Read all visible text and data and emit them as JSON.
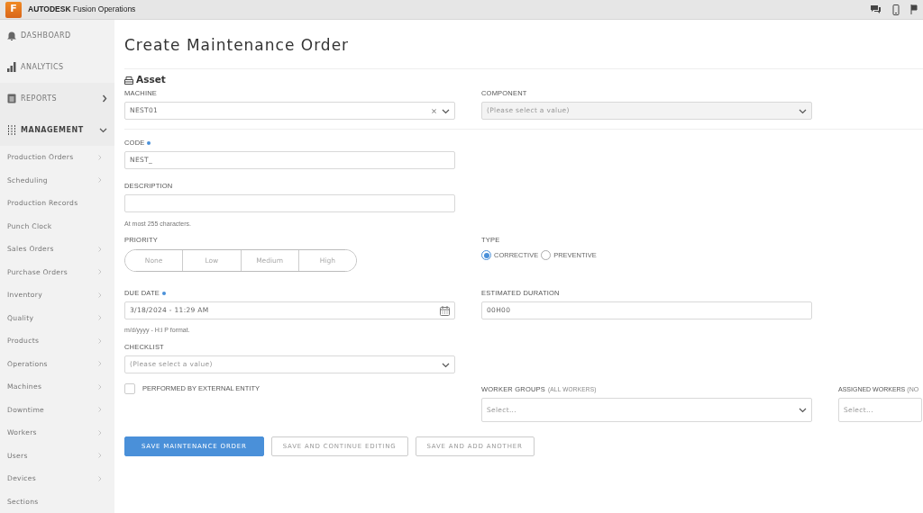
{
  "app": {
    "logo_letter": "F",
    "brand": "AUTODESK",
    "product": "Fusion Operations"
  },
  "sidebar": {
    "sections": [
      {
        "label": "DASHBOARD"
      },
      {
        "label": "ANALYTICS"
      },
      {
        "label": "REPORTS",
        "expanded": false
      },
      {
        "label": "MANAGEMENT",
        "expanded": true
      }
    ],
    "items": [
      {
        "label": "Production Orders",
        "has_submenu": true
      },
      {
        "label": "Scheduling",
        "has_submenu": true
      },
      {
        "label": "Production Records",
        "has_submenu": false
      },
      {
        "label": "Punch Clock",
        "has_submenu": false
      },
      {
        "label": "Sales Orders",
        "has_submenu": true
      },
      {
        "label": "Purchase Orders",
        "has_submenu": true
      },
      {
        "label": "Inventory",
        "has_submenu": true
      },
      {
        "label": "Quality",
        "has_submenu": true
      },
      {
        "label": "Products",
        "has_submenu": true
      },
      {
        "label": "Operations",
        "has_submenu": true
      },
      {
        "label": "Machines",
        "has_submenu": true
      },
      {
        "label": "Downtime",
        "has_submenu": true
      },
      {
        "label": "Workers",
        "has_submenu": true
      },
      {
        "label": "Users",
        "has_submenu": true
      },
      {
        "label": "Devices",
        "has_submenu": true
      },
      {
        "label": "Sections",
        "has_submenu": false
      }
    ]
  },
  "page": {
    "title": "Create Maintenance Order"
  },
  "asset": {
    "heading": "Asset",
    "machine": {
      "label": "MACHINE",
      "value": "NEST01",
      "clearable": true
    },
    "component": {
      "label": "COMPONENT",
      "placeholder": "(Please select a value)",
      "disabled": true
    }
  },
  "code": {
    "label": "CODE",
    "required": true,
    "value": "NEST_"
  },
  "description": {
    "label": "DESCRIPTION",
    "hint": "At most 255 characters."
  },
  "priority": {
    "label": "PRIORITY",
    "options": [
      {
        "label": "None",
        "selected": false
      },
      {
        "label": "Low",
        "selected": false
      },
      {
        "label": "Medium",
        "selected": false
      },
      {
        "label": "High",
        "selected": false
      }
    ]
  },
  "type": {
    "label": "TYPE",
    "options": [
      {
        "label": "CORRECTIVE",
        "selected": true
      },
      {
        "label": "PREVENTIVE",
        "selected": false
      }
    ]
  },
  "due_date": {
    "label": "DUE DATE",
    "required": true,
    "value": "3/18/2024 - 11:29 AM",
    "hint": "m/d/yyyy - H:i P format."
  },
  "estimated_duration": {
    "label": "ESTIMATED DURATION",
    "value": "00H00"
  },
  "checklist": {
    "label": "CHECKLIST",
    "placeholder": "(Please select a value)"
  },
  "external": {
    "label": "PERFORMED BY EXTERNAL ENTITY",
    "checked": false
  },
  "worker_groups": {
    "label": "WORKER GROUPS",
    "note": "(ALL WORKERS)",
    "placeholder": "Select..."
  },
  "assigned_workers": {
    "label": "ASSIGNED WORKERS",
    "note": "(NO",
    "placeholder": "Select..."
  },
  "buttons": [
    {
      "label": "SAVE MAINTENANCE ORDER",
      "kind": "primary"
    },
    {
      "label": "SAVE AND CONTINUE EDITING",
      "kind": "secondary"
    },
    {
      "label": "SAVE AND ADD ANOTHER",
      "kind": "secondary"
    }
  ]
}
